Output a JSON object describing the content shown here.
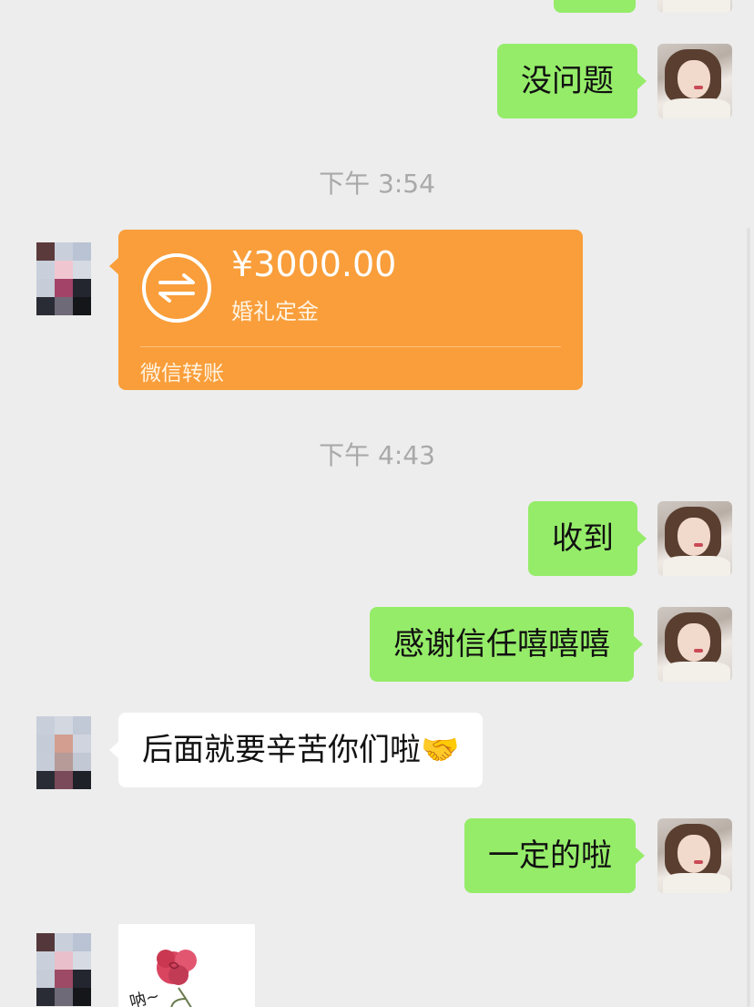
{
  "colors": {
    "background": "#ededed",
    "self_bubble": "#95ec69",
    "other_bubble": "#ffffff",
    "transfer_card": "#f99e3a",
    "timestamp_text": "#a9a9a9"
  },
  "messages": {
    "m1": {
      "sender": "self",
      "text": "没问题"
    },
    "time1": "下午 3:54",
    "transfer": {
      "sender": "other",
      "icon": "transfer-arrows-icon",
      "amount": "¥3000.00",
      "note": "婚礼定金",
      "label": "微信转账"
    },
    "time2": "下午 4:43",
    "m2": {
      "sender": "self",
      "text": "收到"
    },
    "m3": {
      "sender": "self",
      "text": "感谢信任嘻嘻嘻"
    },
    "m4": {
      "sender": "other",
      "text": "后面就要辛苦你们啦🤝"
    },
    "m5": {
      "sender": "self",
      "text": "一定的啦"
    },
    "sticker": {
      "sender": "other",
      "caption": "呐~",
      "icon": "rose-sticker"
    }
  }
}
